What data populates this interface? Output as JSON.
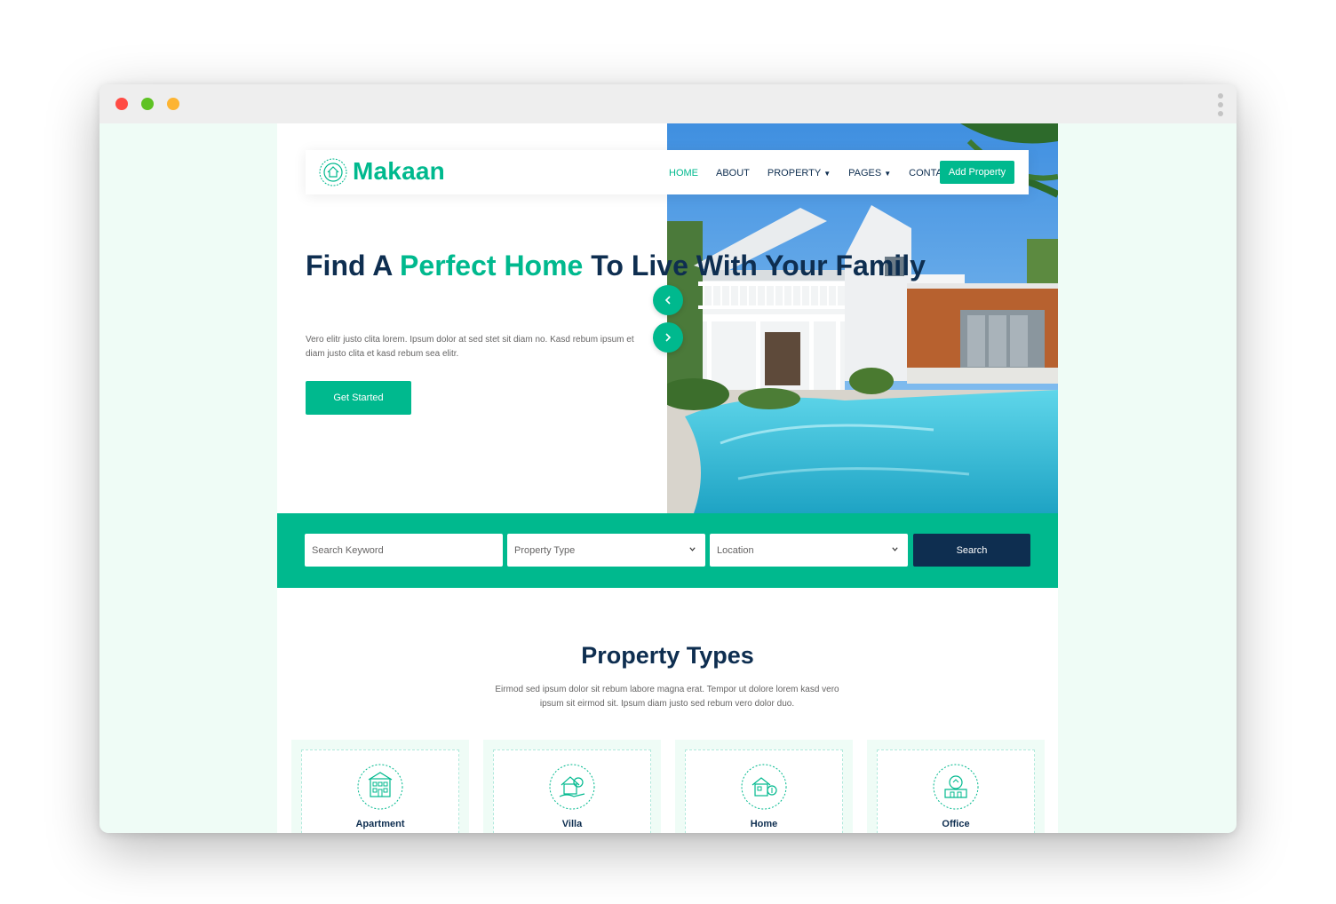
{
  "brand": {
    "name": "Makaan",
    "accent": "#00b98e",
    "dark": "#0e2e50"
  },
  "nav": {
    "items": [
      {
        "label": "HOME",
        "dropdown": false,
        "active": true
      },
      {
        "label": "ABOUT",
        "dropdown": false,
        "active": false
      },
      {
        "label": "PROPERTY",
        "dropdown": true,
        "active": false
      },
      {
        "label": "PAGES",
        "dropdown": true,
        "active": false
      },
      {
        "label": "CONTACT",
        "dropdown": false,
        "active": false
      }
    ],
    "cta": "Add Property"
  },
  "hero": {
    "title_part1": "Find A ",
    "title_highlight": "Perfect Home",
    "title_part2": " To Live With Your Family",
    "text": "Vero elitr justo clita lorem. Ipsum dolor at sed stet sit diam no. Kasd rebum ipsum et diam justo clita et kasd rebum sea elitr.",
    "button": "Get Started",
    "prev_icon": "chevron-left-icon",
    "next_icon": "chevron-right-icon"
  },
  "search": {
    "keyword_placeholder": "Search Keyword",
    "property_type": "Property Type",
    "location": "Location",
    "button": "Search"
  },
  "property_types": {
    "title": "Property Types",
    "text": "Eirmod sed ipsum dolor sit rebum labore magna erat. Tempor ut dolore lorem kasd vero ipsum sit eirmod sit. Ipsum diam justo sed rebum vero dolor duo.",
    "items": [
      {
        "label": "Apartment",
        "icon": "apartment-icon"
      },
      {
        "label": "Villa",
        "icon": "villa-icon"
      },
      {
        "label": "Home",
        "icon": "home-icon"
      },
      {
        "label": "Office",
        "icon": "office-icon"
      }
    ]
  }
}
